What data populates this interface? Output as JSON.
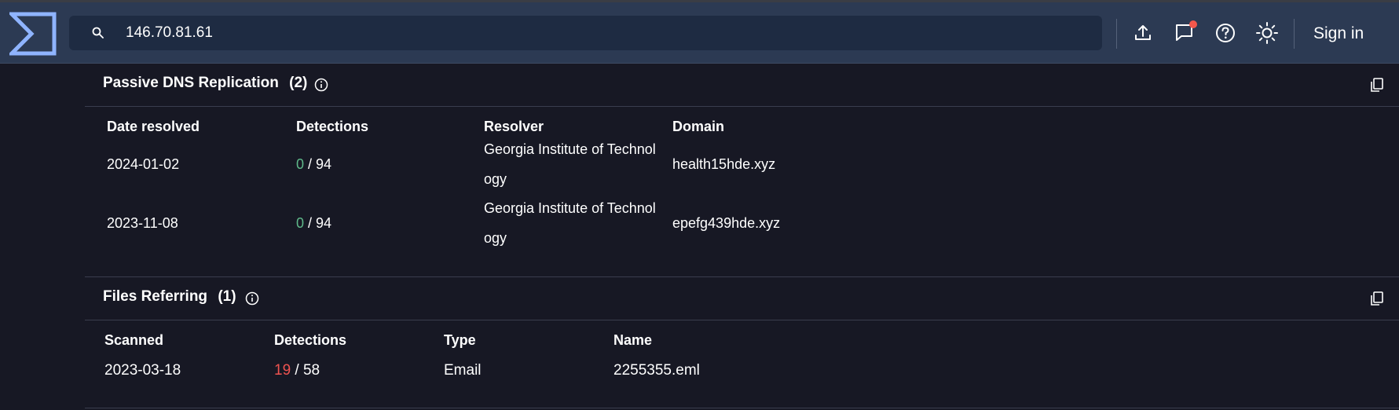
{
  "search": {
    "value": "146.70.81.61"
  },
  "header": {
    "sign_in": "Sign in"
  },
  "passive_dns": {
    "title": "Passive DNS Replication",
    "count": "(2)",
    "columns": [
      "Date resolved",
      "Detections",
      "Resolver",
      "Domain"
    ],
    "rows": [
      {
        "date": "2024-01-02",
        "detections_pos": "0",
        "detections_total": " / 94",
        "resolver_line1": "Georgia Institute of Technol",
        "resolver_line2": "ogy",
        "domain": "health15hde.xyz"
      },
      {
        "date": "2023-11-08",
        "detections_pos": "0",
        "detections_total": " / 94",
        "resolver_line1": "Georgia Institute of Technol",
        "resolver_line2": "ogy",
        "domain": "epefg439hde.xyz"
      }
    ]
  },
  "files_referring": {
    "title": "Files Referring",
    "count": "(1)",
    "columns": [
      "Scanned",
      "Detections",
      "Type",
      "Name"
    ],
    "rows": [
      {
        "scanned": "2023-03-18",
        "detections_pos": "19",
        "detections_total": " / 58",
        "type": "Email",
        "name": "2255355.eml"
      }
    ]
  },
  "colors": {
    "header_bg": "#2c3a53",
    "page_bg": "#171824",
    "accent_logo": "#8fb4ff",
    "detect_clean": "#5fb98a",
    "detect_malicious": "#ef5350",
    "notification_dot": "#f4574b"
  },
  "icons": [
    "logo-icon",
    "search-icon",
    "upload-icon",
    "chat-icon",
    "help-icon",
    "theme-icon",
    "info-icon",
    "copy-icon"
  ]
}
